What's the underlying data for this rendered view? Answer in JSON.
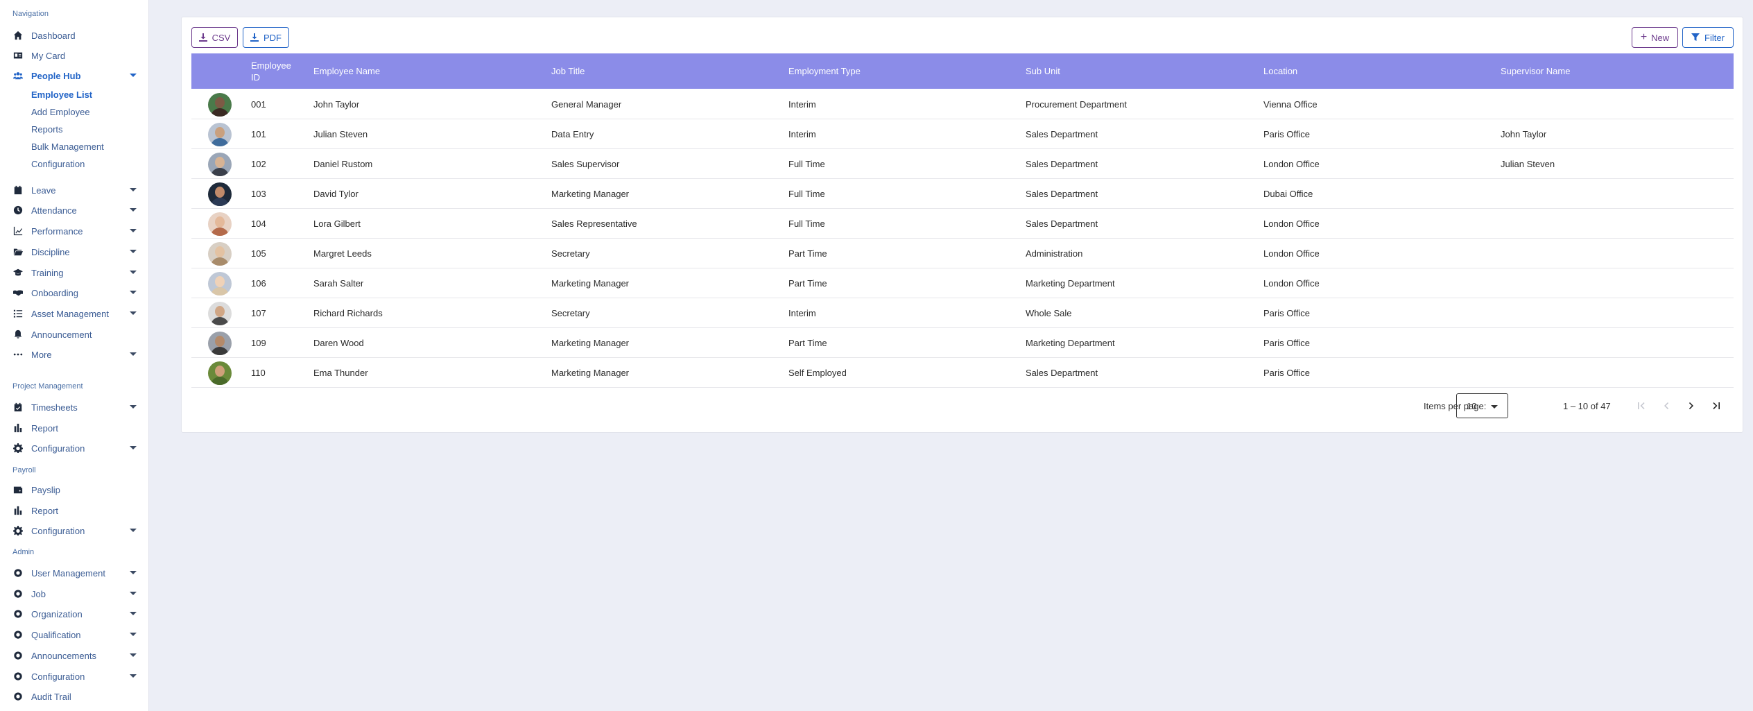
{
  "sidebar": {
    "sections": {
      "navigation": "Navigation",
      "project_management": "Project Management",
      "payroll": "Payroll",
      "admin": "Admin"
    },
    "nav": [
      {
        "label": "Dashboard",
        "icon": "home-icon"
      },
      {
        "label": "My Card",
        "icon": "id-card-icon"
      },
      {
        "label": "People Hub",
        "icon": "users-icon"
      }
    ],
    "people_hub_sub": [
      "Employee List",
      "Add Employee",
      "Reports",
      "Bulk Management",
      "Configuration"
    ],
    "nav2": [
      {
        "label": "Leave",
        "icon": "calendar-icon"
      },
      {
        "label": "Attendance",
        "icon": "clock-icon"
      },
      {
        "label": "Performance",
        "icon": "chart-line-icon"
      },
      {
        "label": "Discipline",
        "icon": "folder-icon"
      },
      {
        "label": "Training",
        "icon": "graduation-cap-icon"
      },
      {
        "label": "Onboarding",
        "icon": "handshake-icon"
      },
      {
        "label": "Asset Management",
        "icon": "list-icon"
      },
      {
        "label": "Announcement",
        "icon": "bell-icon"
      },
      {
        "label": "More",
        "icon": "ellipsis-icon"
      }
    ],
    "project": [
      {
        "label": "Timesheets",
        "icon": "calendar-check-icon"
      },
      {
        "label": "Report",
        "icon": "bar-chart-icon"
      },
      {
        "label": "Configuration",
        "icon": "gear-icon"
      }
    ],
    "payroll": [
      {
        "label": "Payslip",
        "icon": "wallet-icon"
      },
      {
        "label": "Report",
        "icon": "bar-chart-icon"
      },
      {
        "label": "Configuration",
        "icon": "gear-icon"
      }
    ],
    "admin": [
      {
        "label": "User Management",
        "icon": "circle-icon"
      },
      {
        "label": "Job",
        "icon": "circle-icon"
      },
      {
        "label": "Organization",
        "icon": "circle-icon"
      },
      {
        "label": "Qualification",
        "icon": "circle-icon"
      },
      {
        "label": "Announcements",
        "icon": "circle-icon"
      },
      {
        "label": "Configuration",
        "icon": "circle-icon"
      },
      {
        "label": "Audit Trail",
        "icon": "circle-icon"
      }
    ]
  },
  "toolbar": {
    "csv_label": "CSV",
    "pdf_label": "PDF",
    "new_label": "New",
    "filter_label": "Filter"
  },
  "table": {
    "headers": {
      "id_line1": "Employee",
      "id_line2": "ID",
      "name": "Employee Name",
      "job": "Job Title",
      "type": "Employment Type",
      "subunit": "Sub Unit",
      "location": "Location",
      "supervisor": "Supervisor Name"
    },
    "rows": [
      {
        "id": "001",
        "name": "John Taylor",
        "job": "General Manager",
        "type": "Interim",
        "subunit": "Procurement Department",
        "location": "Vienna Office",
        "supervisor": ""
      },
      {
        "id": "101",
        "name": "Julian Steven",
        "job": "Data Entry",
        "type": "Interim",
        "subunit": "Sales Department",
        "location": "Paris Office",
        "supervisor": "John Taylor"
      },
      {
        "id": "102",
        "name": "Daniel Rustom",
        "job": "Sales Supervisor",
        "type": "Full Time",
        "subunit": "Sales Department",
        "location": "London Office",
        "supervisor": "Julian Steven"
      },
      {
        "id": "103",
        "name": "David Tylor",
        "job": "Marketing Manager",
        "type": "Full Time",
        "subunit": "Sales Department",
        "location": "Dubai Office",
        "supervisor": ""
      },
      {
        "id": "104",
        "name": "Lora Gilbert",
        "job": "Sales Representative",
        "type": "Full Time",
        "subunit": "Sales Department",
        "location": "London Office",
        "supervisor": ""
      },
      {
        "id": "105",
        "name": "Margret Leeds",
        "job": "Secretary",
        "type": "Part Time",
        "subunit": "Administration",
        "location": "London Office",
        "supervisor": ""
      },
      {
        "id": "106",
        "name": "Sarah Salter",
        "job": "Marketing Manager",
        "type": "Part Time",
        "subunit": "Marketing Department",
        "location": "London Office",
        "supervisor": ""
      },
      {
        "id": "107",
        "name": "Richard Richards",
        "job": "Secretary",
        "type": "Interim",
        "subunit": "Whole Sale",
        "location": "Paris Office",
        "supervisor": ""
      },
      {
        "id": "109",
        "name": "Daren Wood",
        "job": "Marketing Manager",
        "type": "Part Time",
        "subunit": "Marketing Department",
        "location": "Paris Office",
        "supervisor": ""
      },
      {
        "id": "110",
        "name": "Ema Thunder",
        "job": "Marketing Manager",
        "type": "Self Employed",
        "subunit": "Sales Department",
        "location": "Paris Office",
        "supervisor": ""
      }
    ]
  },
  "paginator": {
    "items_per_page_label": "Items per page:",
    "page_size": "10",
    "range": "1 – 10 of 47"
  },
  "colors": {
    "accent": "#2264c7",
    "header_bg": "#8b8ce8",
    "export_button": "#6c3a8c"
  }
}
